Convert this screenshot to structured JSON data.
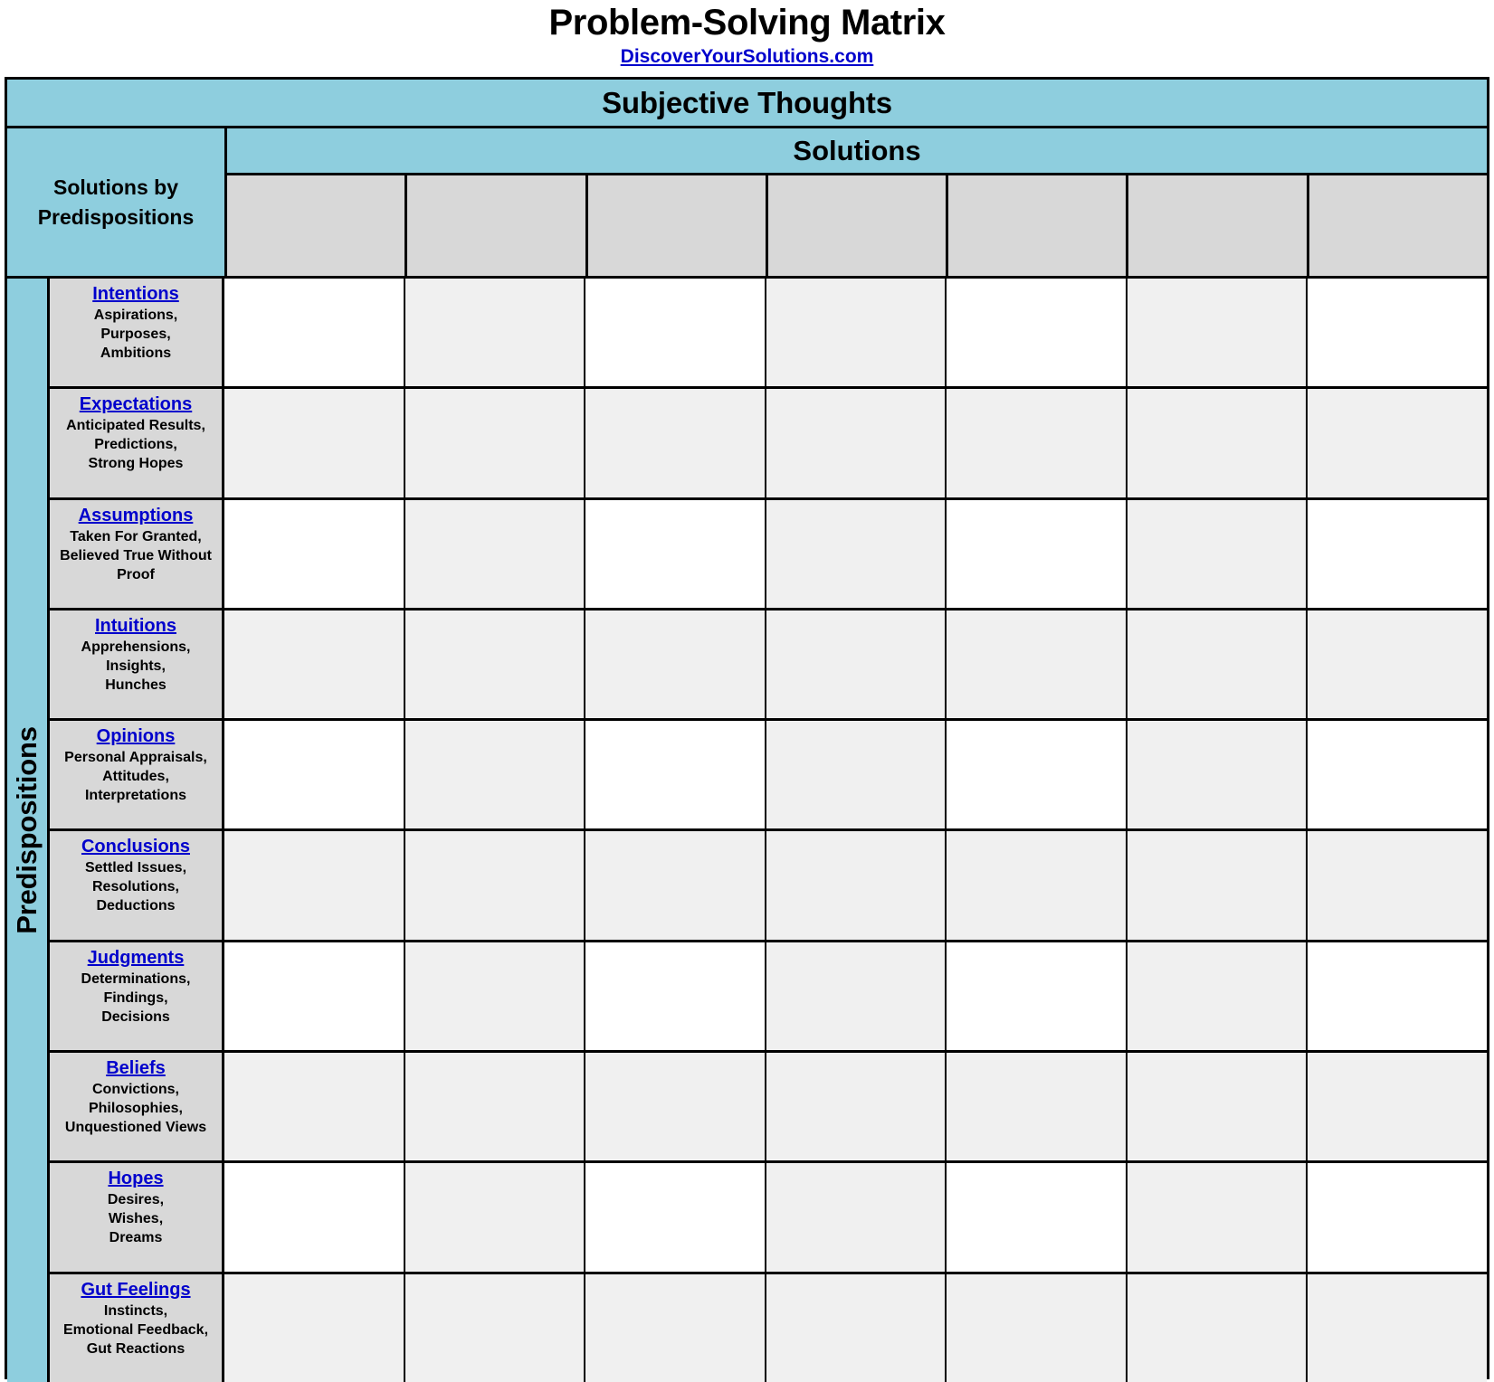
{
  "header": {
    "title": "Problem-Solving Matrix",
    "url": "DiscoverYourSolutions.com"
  },
  "matrix": {
    "banner": "Subjective Thoughts",
    "corner_label": "Solutions\nby\nPredispositions",
    "columns_header": "Solutions",
    "row_axis_label": "Predispositions",
    "column_count": 7,
    "column_headers": [
      "",
      "",
      "",
      "",
      "",
      "",
      ""
    ],
    "colors": {
      "banner_bg": "#8ECEDE",
      "header_slot_bg": "#D8D8D8",
      "row_label_bg": "#D8D8D8",
      "cell_white": "#FFFFFF",
      "cell_tint": "#F0F0F0",
      "link": "#0000CC",
      "border": "#000000"
    },
    "rows": [
      {
        "term": "Intentions",
        "desc": "Aspirations,\nPurposes,\nAmbitions",
        "pattern": "alt"
      },
      {
        "term": "Expectations",
        "desc": "Anticipated Results,\nPredictions,\nStrong Hopes",
        "pattern": "all-tint"
      },
      {
        "term": "Assumptions",
        "desc": "Taken For Granted,\nBelieved True Without\nProof",
        "pattern": "alt"
      },
      {
        "term": "Intuitions",
        "desc": "Apprehensions,\nInsights,\nHunches",
        "pattern": "all-tint"
      },
      {
        "term": "Opinions",
        "desc": "Personal Appraisals,\nAttitudes,\nInterpretations",
        "pattern": "alt"
      },
      {
        "term": "Conclusions",
        "desc": "Settled Issues,\nResolutions,\nDeductions",
        "pattern": "all-tint"
      },
      {
        "term": "Judgments",
        "desc": "Determinations,\nFindings,\nDecisions",
        "pattern": "alt"
      },
      {
        "term": "Beliefs",
        "desc": "Convictions,\nPhilosophies,\nUnquestioned Views",
        "pattern": "all-tint"
      },
      {
        "term": "Hopes",
        "desc": "Desires,\nWishes,\nDreams",
        "pattern": "alt"
      },
      {
        "term": "Gut Feelings",
        "desc": "Instincts,\nEmotional Feedback,\nGut Reactions",
        "pattern": "all-tint"
      }
    ]
  }
}
